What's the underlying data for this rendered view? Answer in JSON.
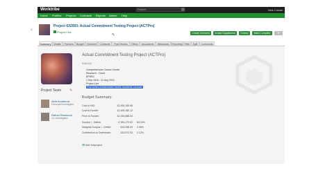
{
  "topbar": {
    "brand": "Worktribe",
    "search_placeholder": "Search",
    "user": "Nick Cowan"
  },
  "nav": {
    "items": [
      "Home",
      "Profiles",
      "Projects",
      "Contracts",
      "Reports",
      "Admin",
      "Help"
    ]
  },
  "project": {
    "title": "Project 632993: Actual Commitment Testing Project (ACTPro)",
    "status": "Project Live"
  },
  "actions": [
    "Create Virement",
    "Create Supplement",
    "Extend",
    "Mark Complete"
  ],
  "tabs": [
    "Summary",
    "Details",
    "Partners",
    "Budget",
    "Virement",
    "Contracts",
    "Post Review",
    "Ethics",
    "Documents",
    "Milestones",
    "Reporting",
    "Risk",
    "Split",
    "Comments"
  ],
  "team": {
    "title": "Project Team",
    "members": [
      {
        "name": "Aida Academic",
        "role": "Principal Investigator"
      },
      {
        "name": "Rahan Research",
        "role": "Co-Investigator"
      }
    ]
  },
  "main": {
    "title": "Actual Commitment Testing Project (ACTPro)",
    "code": "S100116",
    "info": [
      "Comprehensive Cancer Centre",
      "Research - Grant",
      "EPSRC",
      "1 Sep 2016 - 31 Aug 2022",
      "Project Live"
    ],
    "highlight": "Post Award Administrator Noelle Academic Lecturer"
  },
  "budget": {
    "title": "Budget Summary",
    "rows": [
      {
        "label": "Cost to HEI:",
        "value": "£2,495,165.56",
        "pct": ""
      },
      {
        "label": "Cost to Funder:",
        "value": "£2,495,180.12",
        "pct": ""
      },
      {
        "label": "Price to Funder:",
        "value": "£2,150,688.04",
        "pct": ""
      },
      {
        "label": "Surplus / - Deficit:",
        "value": "-£ 394,473.52",
        "pct": "84.19%"
      },
      {
        "label": "Marginal Surplus / - Deficit:",
        "value": "£43,268.26",
        "pct": "2.06%"
      },
      {
        "label": "Contribution to Overheads:",
        "value": "£43,572.93",
        "pct": "2.12%"
      }
    ],
    "add_label": "Add Subproject"
  }
}
